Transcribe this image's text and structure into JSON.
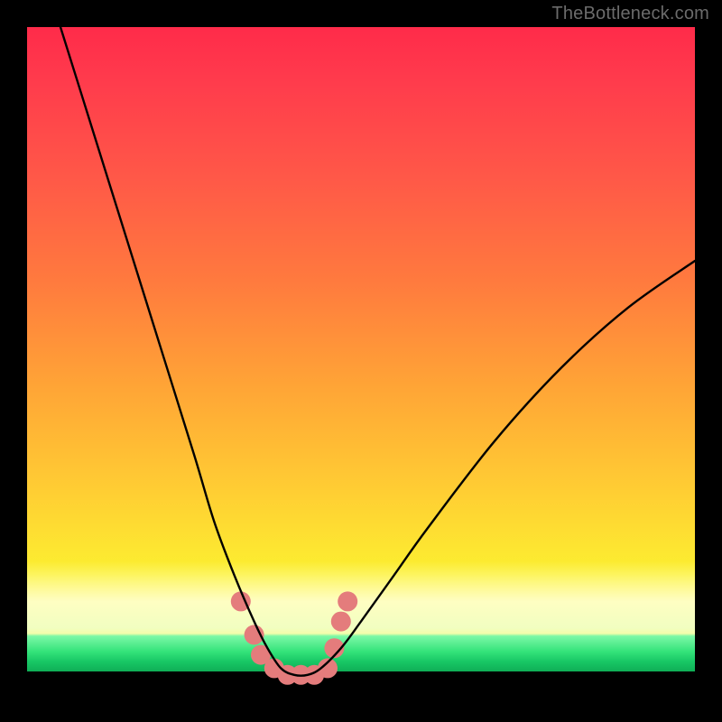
{
  "watermark": "TheBottleneck.com",
  "colors": {
    "frame": "#000000",
    "grad_top": "#ff2b4a",
    "grad_mid": "#ffcf33",
    "grad_green": "#18c765",
    "curve": "#000000",
    "marker": "#e47c7c"
  },
  "chart_data": {
    "type": "line",
    "title": "",
    "xlabel": "",
    "ylabel": "",
    "xlim": [
      0,
      100
    ],
    "ylim": [
      0,
      100
    ],
    "note": "Qualitative bottleneck curve on a color-gradient background. No numeric axis ticks are visible; values below are estimated from pixel positions as percent of plot area (0 = left/bottom, 100 = right/top).",
    "series": [
      {
        "name": "bottleneck-curve",
        "x": [
          5,
          10,
          15,
          20,
          25,
          28,
          31,
          34,
          36,
          38,
          40,
          42,
          44,
          47,
          50,
          55,
          60,
          70,
          80,
          90,
          100
        ],
        "y": [
          100,
          84,
          68,
          52,
          36,
          26,
          18,
          11,
          7,
          4,
          3,
          3,
          4,
          7,
          11,
          18,
          25,
          38,
          49,
          58,
          65
        ]
      }
    ],
    "markers": {
      "name": "highlight-cluster",
      "note": "Salmon-pink dots clustered around the valley floor.",
      "points": [
        {
          "x": 32,
          "y": 14
        },
        {
          "x": 34,
          "y": 9
        },
        {
          "x": 35,
          "y": 6
        },
        {
          "x": 37,
          "y": 4
        },
        {
          "x": 39,
          "y": 3
        },
        {
          "x": 41,
          "y": 3
        },
        {
          "x": 43,
          "y": 3
        },
        {
          "x": 45,
          "y": 4
        },
        {
          "x": 46,
          "y": 7
        },
        {
          "x": 47,
          "y": 11
        },
        {
          "x": 48,
          "y": 14
        }
      ]
    },
    "gradient_bands": [
      {
        "from_y": 100,
        "to_y": 20,
        "color": "red-to-yellow"
      },
      {
        "from_y": 20,
        "to_y": 9,
        "color": "yellow-to-pale"
      },
      {
        "from_y": 9,
        "to_y": 3.5,
        "color": "green"
      },
      {
        "from_y": 3.5,
        "to_y": 0,
        "color": "black"
      }
    ]
  }
}
